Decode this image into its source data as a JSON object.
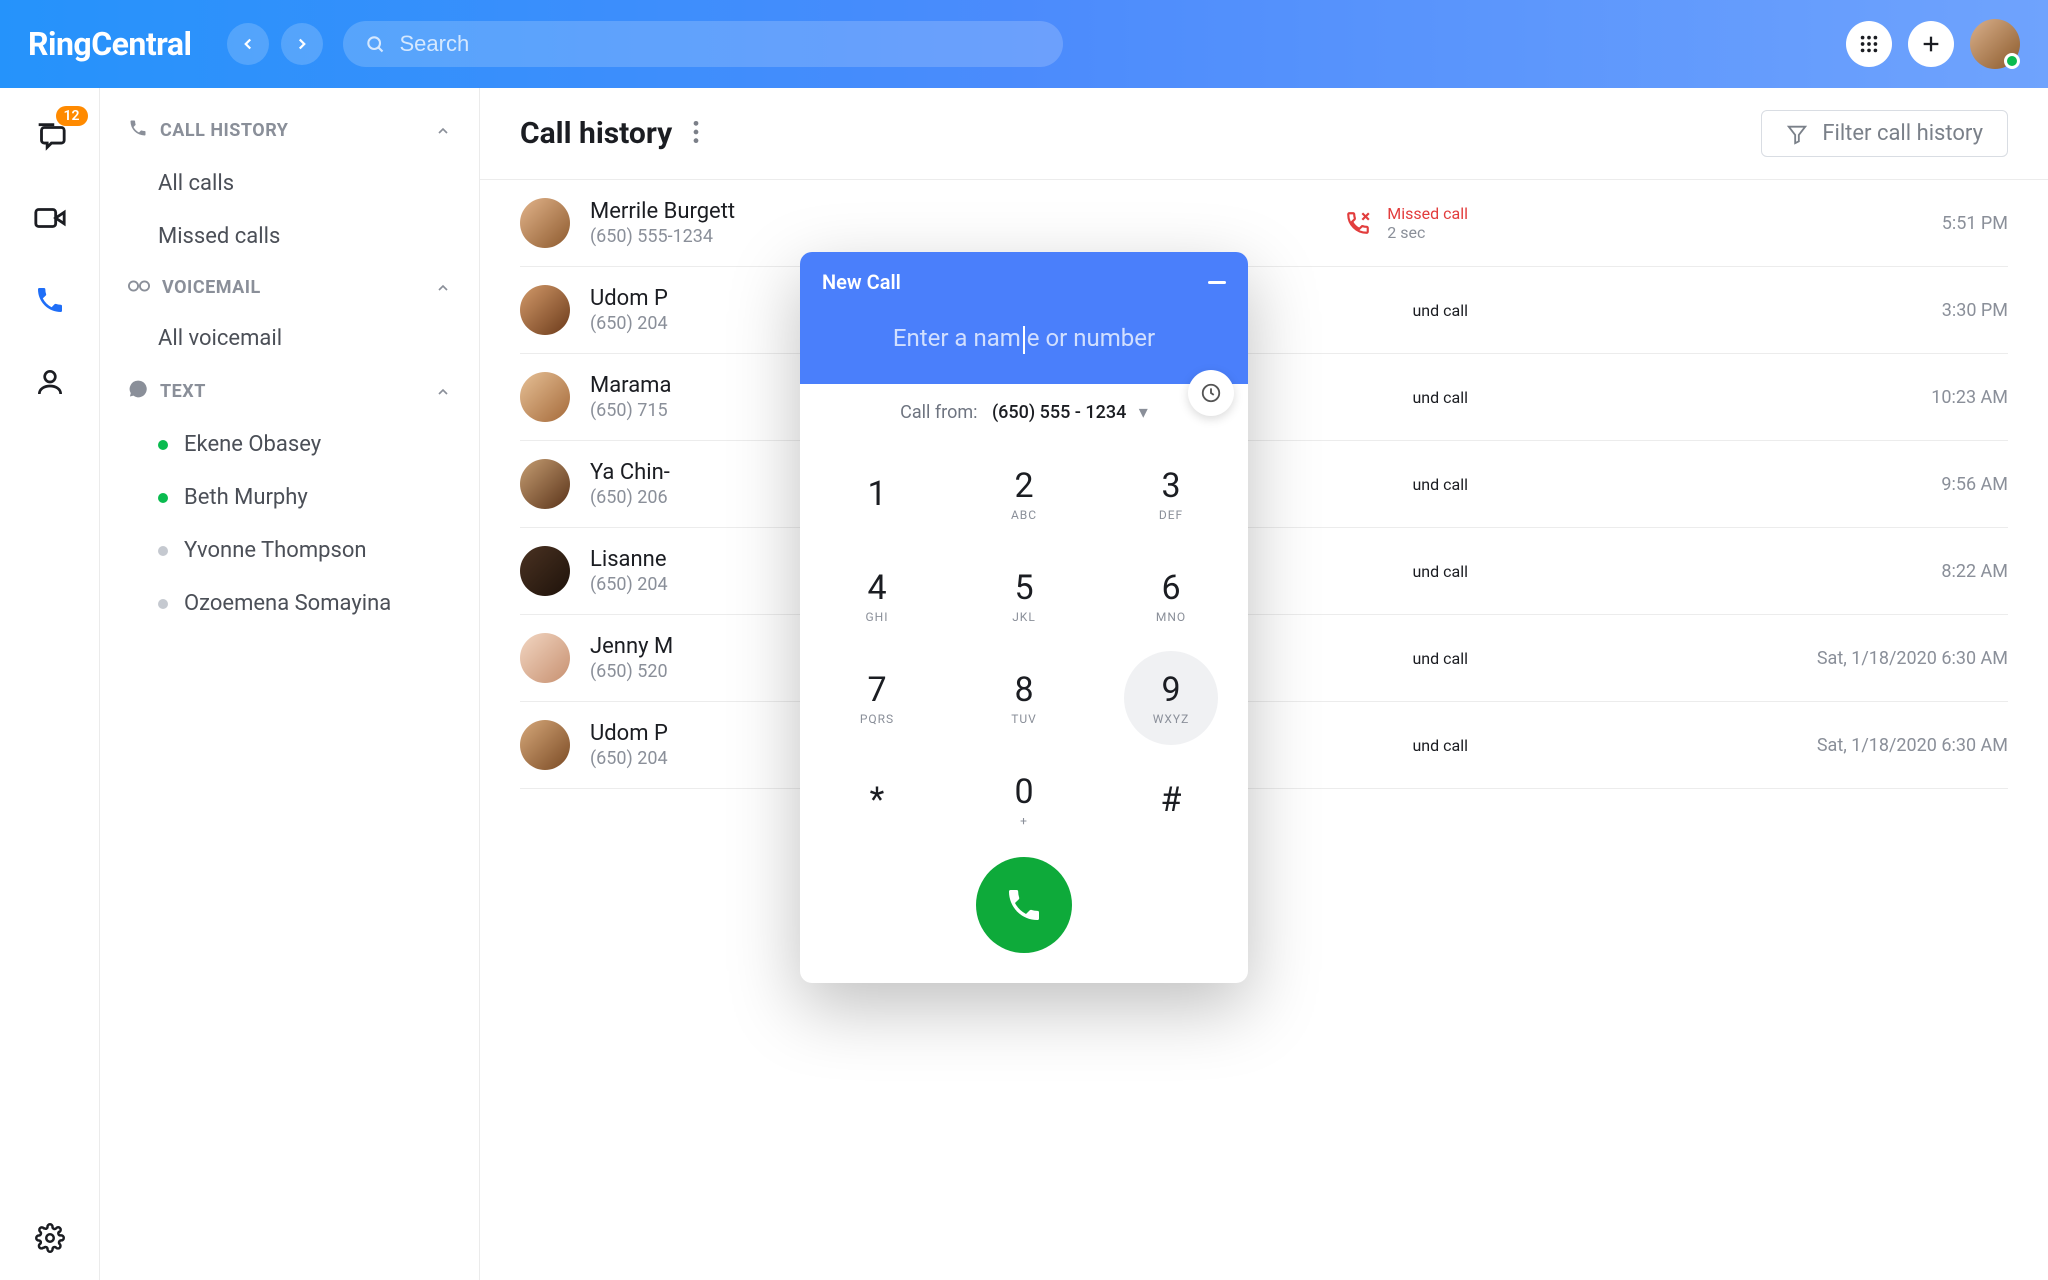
{
  "brand": "RingCentral",
  "search_placeholder": "Search",
  "rail_badge": "12",
  "content": {
    "title": "Call history",
    "filter_label": "Filter call history"
  },
  "nav": {
    "sections": [
      {
        "label": "CALL HISTORY",
        "items": [
          "All calls",
          "Missed calls"
        ]
      },
      {
        "label": "VOICEMAIL",
        "items": [
          "All voicemail"
        ]
      },
      {
        "label": "TEXT",
        "items": [
          {
            "label": "Ekene Obasey",
            "online": true
          },
          {
            "label": "Beth Murphy",
            "online": true
          },
          {
            "label": "Yvonne Thompson",
            "online": false
          },
          {
            "label": "Ozoemena Somayina",
            "online": false
          }
        ]
      }
    ]
  },
  "calls": [
    {
      "name": "Merrile Burgett",
      "number": "(650) 555-1234",
      "type": "Missed call",
      "duration": "2 sec",
      "missed": true,
      "time": "5:51 PM"
    },
    {
      "name": "Udom P",
      "number": "(650) 204",
      "type": "und call",
      "duration": "",
      "missed": false,
      "time": "3:30 PM"
    },
    {
      "name": "Marama",
      "number": "(650) 715",
      "type": "und call",
      "duration": "",
      "missed": false,
      "time": "10:23 AM"
    },
    {
      "name": "Ya Chin-",
      "number": "(650) 206",
      "type": "und call",
      "duration": "",
      "missed": false,
      "time": "9:56 AM"
    },
    {
      "name": "Lisanne",
      "number": "(650) 204",
      "type": "und call",
      "duration": "",
      "missed": false,
      "time": "8:22 AM"
    },
    {
      "name": "Jenny M",
      "number": "(650) 520",
      "type": "und call",
      "duration": "",
      "missed": false,
      "time": "Sat, 1/18/2020 6:30 AM"
    },
    {
      "name": "Udom P",
      "number": "(650) 204",
      "type": "und call",
      "duration": "",
      "missed": false,
      "time": "Sat, 1/18/2020 6:30 AM"
    }
  ],
  "dialer": {
    "title": "New Call",
    "placeholder_left": "Enter a nam",
    "placeholder_right": "e or number",
    "from_label": "Call from:",
    "from_number": "(650) 555 - 1234",
    "keys": [
      [
        {
          "n": "1",
          "s": ""
        },
        {
          "n": "2",
          "s": "ABC"
        },
        {
          "n": "3",
          "s": "DEF"
        }
      ],
      [
        {
          "n": "4",
          "s": "GHI"
        },
        {
          "n": "5",
          "s": "JKL"
        },
        {
          "n": "6",
          "s": "MNO"
        }
      ],
      [
        {
          "n": "7",
          "s": "PQRS"
        },
        {
          "n": "8",
          "s": "TUV"
        },
        {
          "n": "9",
          "s": "WXYZ"
        }
      ],
      [
        {
          "n": "*",
          "s": ""
        },
        {
          "n": "0",
          "s": "+"
        },
        {
          "n": "#",
          "s": ""
        }
      ]
    ]
  }
}
